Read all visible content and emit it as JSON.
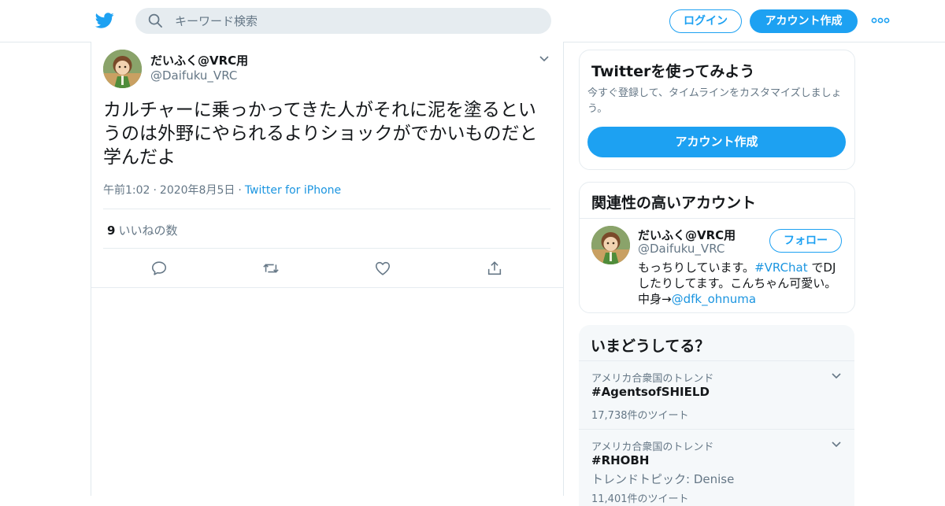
{
  "colors": {
    "brand": "#1da1f2",
    "link": "#1b95e0",
    "muted": "#657786",
    "text": "#14171a"
  },
  "header": {
    "search_placeholder": "キーワード検索",
    "login_label": "ログイン",
    "signup_label": "アカウント作成"
  },
  "tweet": {
    "name": "だいふく@VRC用",
    "handle": "@Daifuku_VRC",
    "text": "カルチャーに乗っかってきた人がそれに泥を塗るというのは外野にやられるよりショックがでかいものだと学んだよ",
    "time": "午前1:02",
    "date": "2020年8月5日",
    "source": "Twitter for iPhone",
    "likes_count": "9",
    "likes_label": "いいねの数"
  },
  "sidebar": {
    "signup_card": {
      "title": "Twitterを使ってみよう",
      "description": "今すぐ登録して、タイムラインをカスタマイズしましょう。",
      "button_label": "アカウント作成"
    },
    "related": {
      "title": "関連性の高いアカウント",
      "name": "だいふく@VRC用",
      "handle": "@Daifuku_VRC",
      "follow_label": "フォロー",
      "bio_part1": "もっちりしています。",
      "bio_hashtag": "#VRChat",
      "bio_part2": " でDJしたりしてます。こんちゃん可愛い。　　中身→",
      "bio_mention": "@dfk_ohnuma"
    },
    "trends": {
      "title": "いまどうしてる？",
      "items": [
        {
          "location": "アメリカ合衆国のトレンド",
          "name": "#AgentsofSHIELD",
          "count": "17,738件のツイート"
        },
        {
          "location": "アメリカ合衆国のトレンド",
          "name": "#RHOBH",
          "topic": "トレンドトピック: Denise",
          "count": "11,401件のツイート"
        }
      ]
    }
  }
}
